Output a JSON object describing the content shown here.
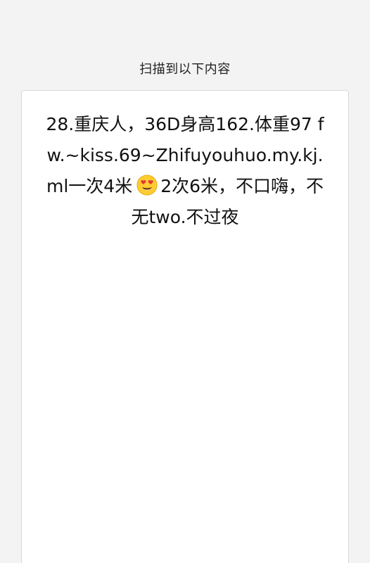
{
  "header": {
    "title": "扫描到以下内容"
  },
  "content": {
    "text_before_emoji": "28.重庆人，36D身高162.体重97 fw.~kiss.69~Zhifuyouhuo.my.kj.ml一次4米",
    "emoji": "smiling-face-with-heart-eyes-icon",
    "text_after_emoji": "2次6米，不口嗨，不无two.不过夜"
  }
}
